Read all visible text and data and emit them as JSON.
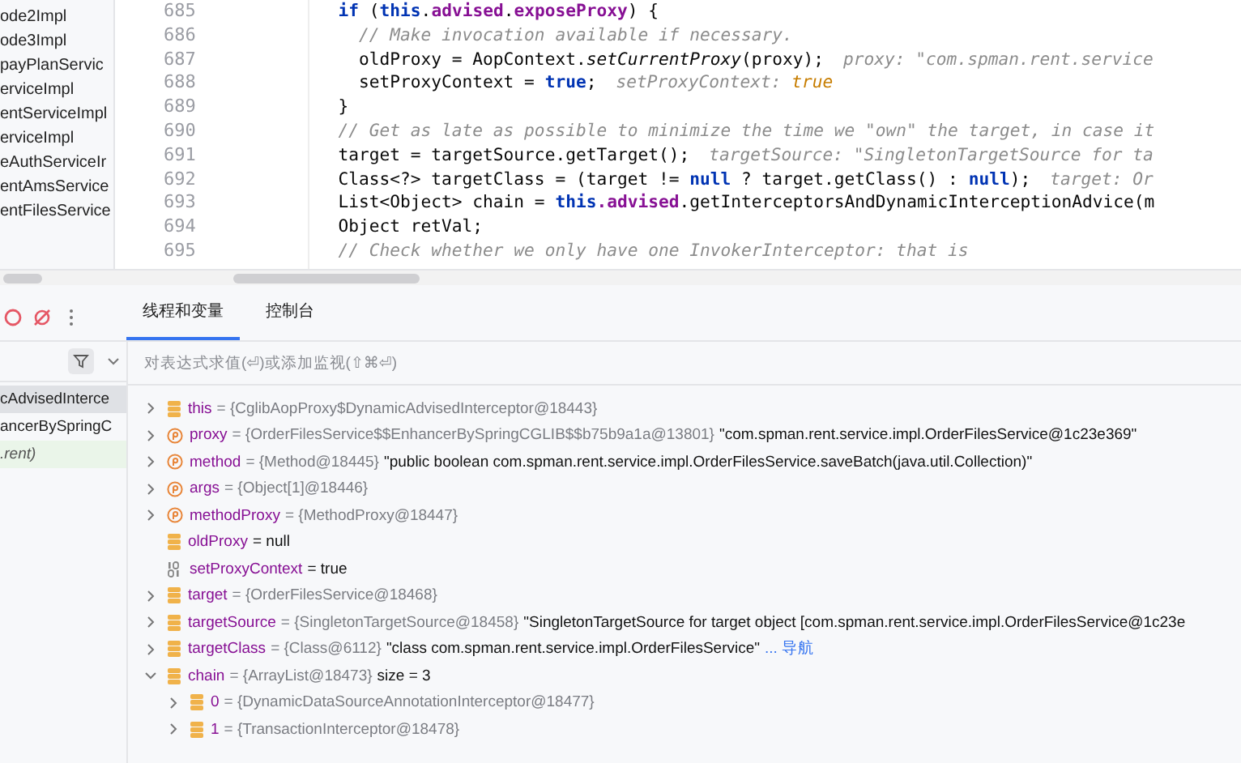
{
  "project_tree": {
    "items": [
      {
        "label": "ode2Impl"
      },
      {
        "label": "ode3Impl"
      },
      {
        "label": "payPlanServic"
      },
      {
        "label": "erviceImpl"
      },
      {
        "label": "entServiceImpl"
      },
      {
        "label": "erviceImpl"
      },
      {
        "label": "eAuthServiceIr"
      },
      {
        "label": "entAmsService"
      },
      {
        "label": "entFilesService"
      }
    ]
  },
  "editor": {
    "lines": [
      {
        "number": "685",
        "tokens": [
          {
            "kind": "keyword",
            "text": "  if"
          },
          {
            "kind": "plain",
            "text": " ("
          },
          {
            "kind": "keyword",
            "text": "this"
          },
          {
            "kind": "plain",
            "text": "."
          },
          {
            "kind": "field",
            "text": "advised"
          },
          {
            "kind": "plain",
            "text": "."
          },
          {
            "kind": "field",
            "text": "exposeProxy"
          },
          {
            "kind": "plain",
            "text": ") {"
          }
        ]
      },
      {
        "number": "686",
        "tokens": [
          {
            "kind": "comment",
            "text": "    // Make invocation available if necessary."
          }
        ]
      },
      {
        "number": "687",
        "tokens": [
          {
            "kind": "plain",
            "text": "    oldProxy = AopContext."
          },
          {
            "kind": "static",
            "text": "setCurrentProxy"
          },
          {
            "kind": "plain",
            "text": "(proxy);"
          },
          {
            "kind": "hint",
            "text": "proxy: \"com.spman.rent.service"
          }
        ]
      },
      {
        "number": "688",
        "tokens": [
          {
            "kind": "plain",
            "text": "    setProxyContext = "
          },
          {
            "kind": "keyword",
            "text": "true"
          },
          {
            "kind": "plain",
            "text": ";"
          },
          {
            "kind": "hint",
            "text": "setProxyContext: "
          },
          {
            "kind": "hintvalue",
            "text": "true"
          }
        ]
      },
      {
        "number": "689",
        "tokens": [
          {
            "kind": "plain",
            "text": "  }"
          }
        ]
      },
      {
        "number": "690",
        "tokens": [
          {
            "kind": "comment",
            "text": "  // Get as late as possible to minimize the time we \"own\" the target, in case it"
          }
        ]
      },
      {
        "number": "691",
        "tokens": [
          {
            "kind": "plain",
            "text": "  target = targetSource.getTarget();"
          },
          {
            "kind": "hint",
            "text": "targetSource: \"SingletonTargetSource for ta"
          }
        ]
      },
      {
        "number": "692",
        "tokens": [
          {
            "kind": "plain",
            "text": "  Class<?> targetClass = (target != "
          },
          {
            "kind": "keyword",
            "text": "null"
          },
          {
            "kind": "plain",
            "text": " ? target.getClass() : "
          },
          {
            "kind": "keyword",
            "text": "null"
          },
          {
            "kind": "plain",
            "text": ");"
          },
          {
            "kind": "hint",
            "text": "target: Or"
          }
        ]
      },
      {
        "number": "693",
        "tokens": [
          {
            "kind": "plain",
            "text": "  List<Object> chain = "
          },
          {
            "kind": "keyword",
            "text": "this"
          },
          {
            "kind": "field",
            "text": ".advised"
          },
          {
            "kind": "plain",
            "text": ".getInterceptorsAndDynamicInterceptionAdvice(m"
          }
        ]
      },
      {
        "number": "694",
        "tokens": [
          {
            "kind": "plain",
            "text": "  Object retVal;"
          }
        ]
      },
      {
        "number": "695",
        "tokens": [
          {
            "kind": "comment",
            "text": "  // Check whether we only have one InvokerInterceptor: that is"
          }
        ]
      }
    ]
  },
  "debugger": {
    "tabs": [
      {
        "label": "线程和变量",
        "selected": true
      },
      {
        "label": "控制台",
        "selected": false
      }
    ],
    "frames": [
      {
        "label": "cAdvisedInterce",
        "selected": true,
        "kind": "normal"
      },
      {
        "label": "ancerBySpringC",
        "selected": false,
        "kind": "normal"
      },
      {
        "label": ".rent)",
        "selected": false,
        "kind": "library"
      }
    ],
    "expression": {
      "placeholder": "对表达式求值(⏎)或添加监视(⇧⌘⏎)"
    },
    "variables": [
      {
        "kind": "field",
        "name": "this",
        "ref": "= {CglibAopProxy$DynamicAdvisedInterceptor@18443}",
        "expandable": true,
        "expanded": false
      },
      {
        "kind": "param",
        "name": "proxy",
        "ref": "= {OrderFilesService$$EnhancerBySpringCGLIB$$b75b9a1a@13801}",
        "value": "\"com.spman.rent.service.impl.OrderFilesService@1c23e369\"",
        "expandable": true,
        "expanded": false
      },
      {
        "kind": "param",
        "name": "method",
        "ref": "= {Method@18445}",
        "value": "\"public boolean com.spman.rent.service.impl.OrderFilesService.saveBatch(java.util.Collection)\"",
        "expandable": true,
        "expanded": false
      },
      {
        "kind": "param",
        "name": "args",
        "ref": "= {Object[1]@18446}",
        "expandable": true,
        "expanded": false
      },
      {
        "kind": "param",
        "name": "methodProxy",
        "ref": "= {MethodProxy@18447}",
        "expandable": true,
        "expanded": false
      },
      {
        "kind": "field",
        "name": "oldProxy",
        "value": "= null",
        "expandable": false
      },
      {
        "kind": "primitive",
        "name": "setProxyContext",
        "value": "= true",
        "expandable": false
      },
      {
        "kind": "field",
        "name": "target",
        "ref": "= {OrderFilesService@18468}",
        "expandable": true,
        "expanded": false
      },
      {
        "kind": "field",
        "name": "targetSource",
        "ref": "= {SingletonTargetSource@18458}",
        "value": "\"SingletonTargetSource for target object [com.spman.rent.service.impl.OrderFilesService@1c23e",
        "expandable": true,
        "expanded": false
      },
      {
        "kind": "field",
        "name": "targetClass",
        "ref": "= {Class@6112}",
        "value": "\"class com.spman.rent.service.impl.OrderFilesService\"",
        "link": "... 导航",
        "expandable": true,
        "expanded": false
      },
      {
        "kind": "field",
        "name": "chain",
        "ref": "= {ArrayList@18473}",
        "value": " size = 3",
        "expandable": true,
        "expanded": true,
        "children": [
          {
            "kind": "field",
            "name": "0",
            "ref": "= {DynamicDataSourceAnnotationInterceptor@18477}",
            "expandable": true,
            "expanded": false
          },
          {
            "kind": "field",
            "name": "1",
            "ref": "= {TransactionInterceptor@18478}",
            "expandable": true,
            "expanded": false
          }
        ]
      }
    ]
  }
}
